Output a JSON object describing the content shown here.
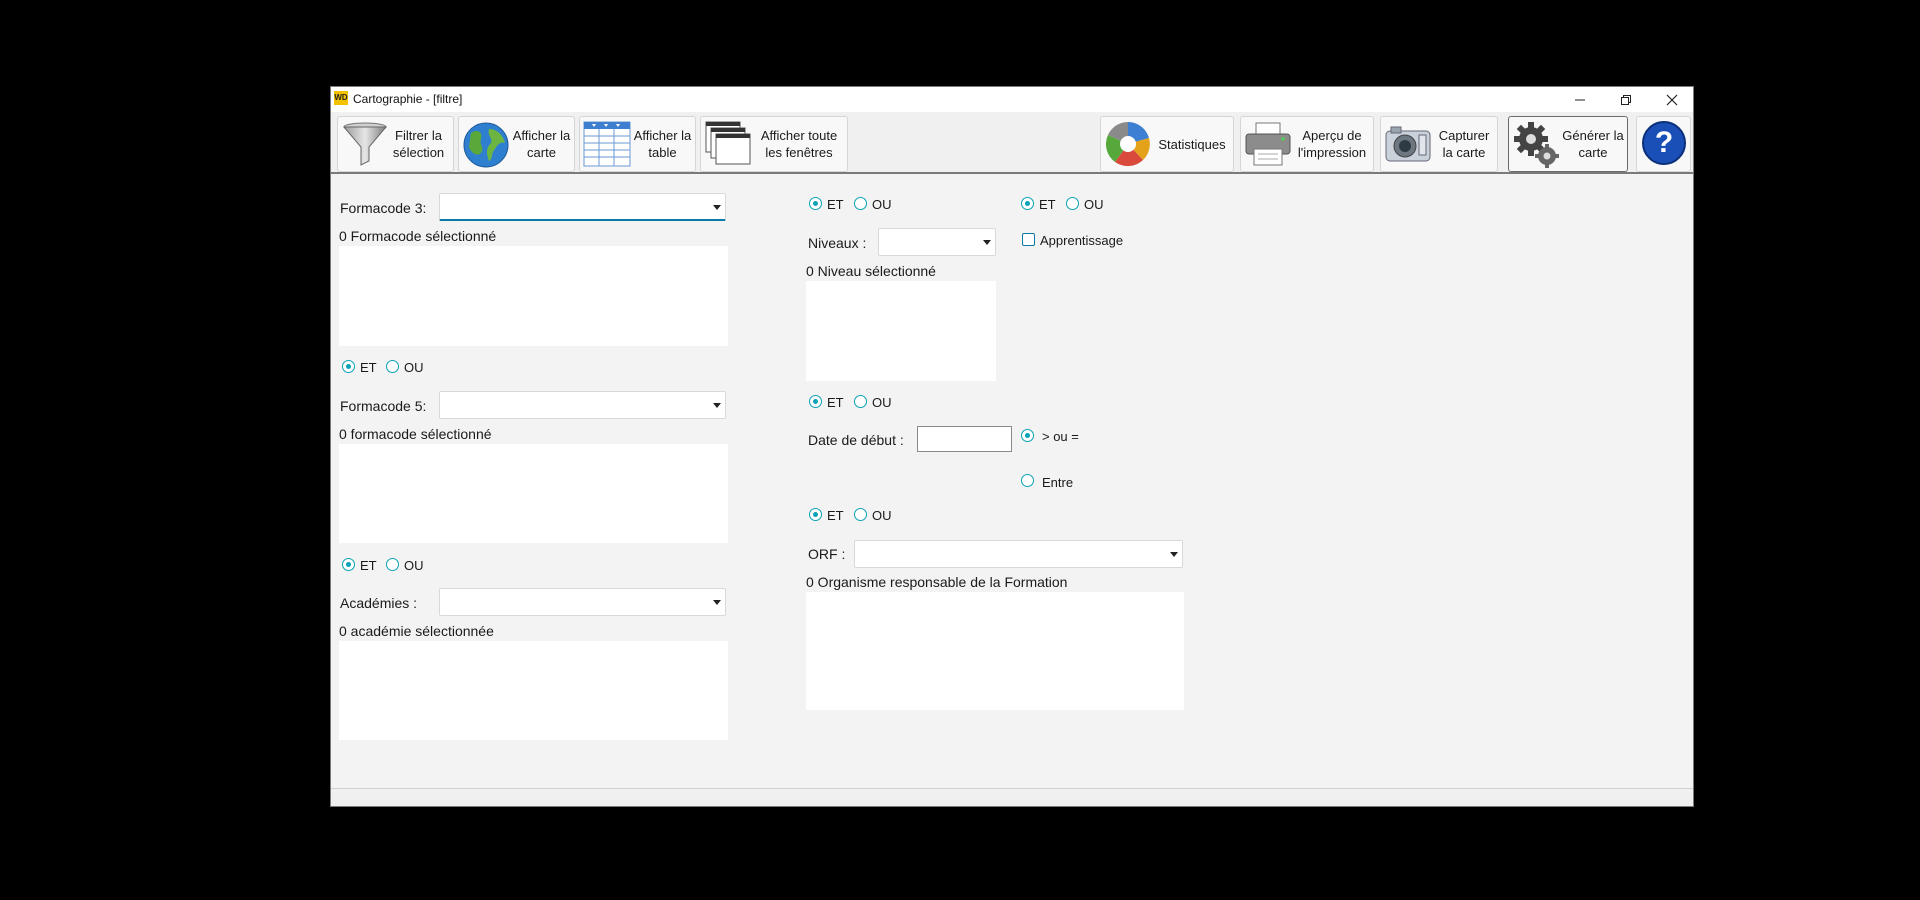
{
  "window": {
    "title": "Cartographie - [filtre]",
    "logo_text": "WD"
  },
  "toolbar": {
    "filter": "Filtrer la sélection",
    "show_map": "Afficher la carte",
    "show_table": "Afficher la table",
    "show_all_windows": "Afficher toute les fenêtres",
    "statistics": "Statistiques",
    "print_preview": "Aperçu de l'impression",
    "capture_map": "Capturer la carte",
    "generate_map": "Générer la carte",
    "help": "?"
  },
  "logic": {
    "and": "ET",
    "or": "OU"
  },
  "formacode3": {
    "label": "Formacode 3:",
    "value": "",
    "count": "0 Formacode sélectionné"
  },
  "formacode5": {
    "label": "Formacode 5:",
    "value": "",
    "count": "0 formacode sélectionné"
  },
  "academies": {
    "label": "Académies :",
    "value": "",
    "count": "0 académie sélectionnée"
  },
  "niveaux": {
    "label": "Niveaux :",
    "value": "",
    "count": "0 Niveau sélectionné"
  },
  "date": {
    "label": "Date de début :",
    "value": "",
    "option_gte": "> ou =",
    "option_between": "Entre"
  },
  "orf": {
    "label": "ORF :",
    "value": "",
    "count": "0 Organisme responsable de la Formation"
  },
  "apprentissage": {
    "label": "Apprentissage",
    "checked": false
  },
  "colors": {
    "accent": "#0aa2b5",
    "focus": "#0a7aa8"
  }
}
